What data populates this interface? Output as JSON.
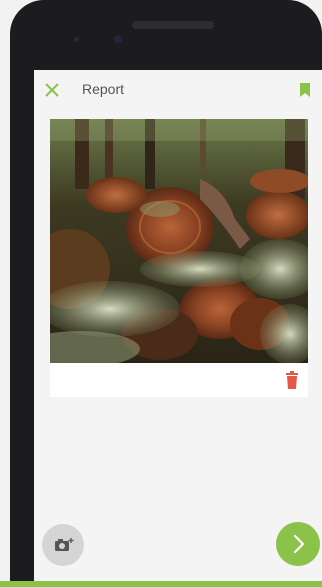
{
  "appbar": {
    "title": "Report",
    "close_icon": "close-icon",
    "bookmark_icon": "bookmark-icon"
  },
  "colors": {
    "accent": "#8bc24a",
    "delete": "#e5574b",
    "camera_fab": "#d4d4d4"
  },
  "card": {
    "photo": "forest-logs-and-ferns",
    "delete_icon": "trash-icon"
  },
  "actions": {
    "camera_icon": "camera-add-icon",
    "next_icon": "chevron-right-icon"
  }
}
